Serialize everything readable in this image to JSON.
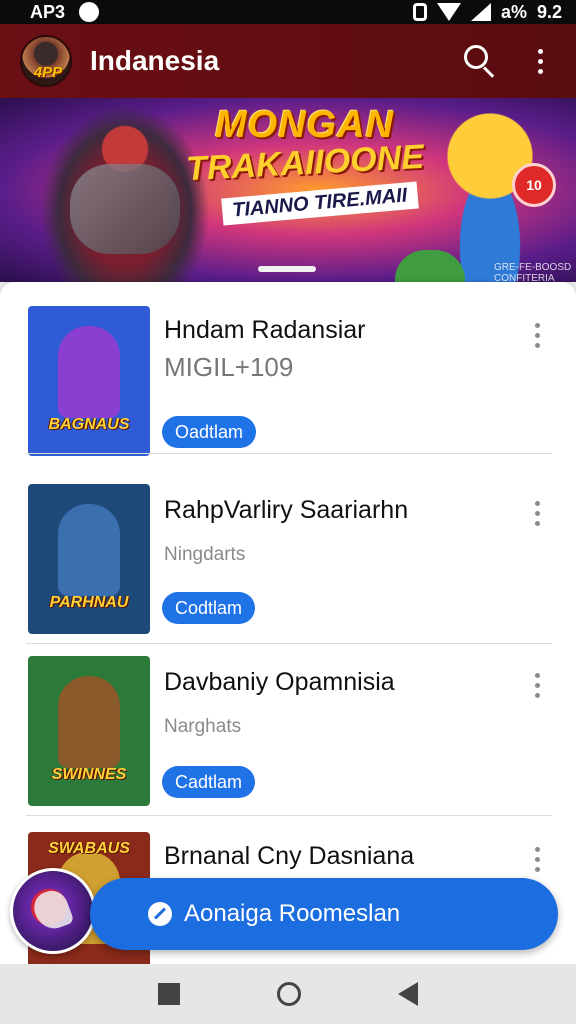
{
  "status_bar": {
    "left_text": "AP3",
    "battery": "a%",
    "time": "9.2"
  },
  "app_bar": {
    "avatar_badge": "4PP",
    "title": "Indanesia"
  },
  "banner": {
    "line1": "MONGAN",
    "line2": "TRAKAIIOONE",
    "line3": "TIANNO TIRE.MAII",
    "coin": "10",
    "fine_print": "GRE-FE-BOOSD CONFITERIA"
  },
  "items": [
    {
      "title": "Hndam Radansiar",
      "subtitle": "MIGIL+109",
      "subtitle_style": "big",
      "thumb_caption": "BAGNAUS",
      "button": "Oadtlam",
      "thumb_bg": "#2f5bd6",
      "fig_color": "#8a3fd0"
    },
    {
      "title": "RahpVarliry Saariarhn",
      "subtitle": "Ningdarts",
      "subtitle_style": "normal",
      "thumb_caption": "PARHNAU",
      "button": "Codtlam",
      "thumb_bg": "#1e4a7a",
      "fig_color": "#3b6fb0"
    },
    {
      "title": "Davbaniy Opamnisia",
      "subtitle": "Narghats",
      "subtitle_style": "normal",
      "thumb_caption": "SWINNES",
      "button": "Cadtlam",
      "thumb_bg": "#2c7a3a",
      "fig_color": "#8a5a2a"
    },
    {
      "title": "Brnanal Cny Dasniana",
      "subtitle": "",
      "subtitle_style": "normal",
      "thumb_caption": "SWABAUS",
      "button": "",
      "thumb_bg": "#8a2a1a",
      "fig_color": "#d0a030"
    }
  ],
  "fab": {
    "label": "Aonaiga Roomeslan"
  }
}
